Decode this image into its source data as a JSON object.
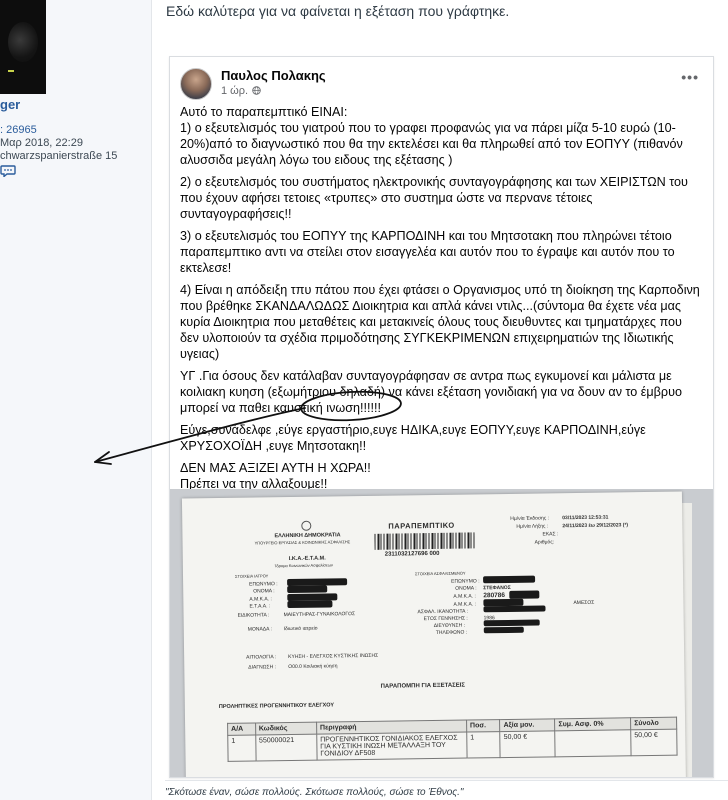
{
  "sidebar": {
    "username": "ger",
    "posts": ": 26965",
    "joined": "Μαρ 2018, 22:29",
    "location": "chwarzspanierstraße 15",
    "chat_icon": "speech-bubble-icon"
  },
  "post": {
    "intro": "Εδώ καλύτερα για να φαίνεται η εξέταση που γράφτηκε."
  },
  "fb": {
    "author": "Παυλος Πολακης",
    "time": "1 ώρ.",
    "audience_icon": "globe-icon",
    "more_icon": "more-horizontal-icon",
    "more": "•••",
    "p1": "Αυτό το παραπεμπτικό ΕΙΝΑΙ:",
    "p2": "1) ο εξευτελισμός του γιατρού που το γραφει προφανώς για να πάρει μίζα 5-10 ευρώ (10-20%)από το διαγνωστικό που θα την εκτελέσει και θα πληρωθεί από τον ΕΟΠΥΥ  (πιθανόν αλυσσιδα μεγάλη λόγω του ειδους της εξέτασης )",
    "p3": "2) ο εξευτελισμός του συστήματος ηλεκτρονικής συνταγογράφησης και των ΧΕΙΡΙΣΤΩΝ του που έχουν αφήσει τετοιες «τρυπες» στο συστημα ώστε να περνανε τέτοιες συνταγογραφήσεις!!",
    "p4": "3) ο εξευτελισμός του ΕΟΠΥΥ της ΚΑΡΠΟΔΙΝΗ και του Μητσοτακη που πληρώνει τέτοιο παραπεμπτικο αντι να στείλει στον εισαγγελέα και αυτόν που το έγραψε και αυτόν που το εκτελεσε!",
    "p5": "4) Είναι η απόδειξη τπυ πάτου που έχει φτάσει ο Οργανισμος υπό τη διοίκηση της Καρποδινη που βρέθηκε ΣΚΑΝΔΑΛΩΔΩΣ Διοικητρια και απλά κάνει ντιλς...(σύντομα θα έχετε νέα μας κυρία Διοικητρια που μεταθέτεις και μετακινείς όλους τους διευθυντες και τμηματάρχες που δεν υλοποιούν τα σχέδια πριμοδότησης ΣΥΓΚΕΚΡΙΜΕΝΩΝ επιχειρηματιών της Ιδιωτικής υγειας)",
    "p6": "ΥΓ .Για όσους δεν κατάλαβαν συνταγογράφησαν σε αντρα πως εγκυμονεί και μάλιστα με κοιλιακη κυηση (εξωμήτριου δηλαδή) να κάνει εξέταση γονιδιακή για να δουν αν το έμβρυο μπορεί να παθει καυστική ινωση!!!!!!",
    "p7": "Εύγε,συνάδελφε ,εύγε εργαστήριο,ευγε ΗΔΙΚΑ,ευγε ΕΟΠΥΥ,ευγε ΚΑΡΠΟΔΙΝΗ,εύγε ΧΡΥΣΟΧΟΪΔΗ ,ευγε Μητσοτακη!!",
    "p8a": "ΔΕΝ ΜΑΣ ΑΞΙΖΕΙ ΑΥΤΗ Η ΧΩΡΑ!!",
    "p8b": "Πρέπει να την αλλαξουμε!!"
  },
  "doc": {
    "ministry": "ΕΛΛΗΝΙΚΗ ΔΗΜΟΚΡΑΤΙΑ",
    "ministry_sub": "ΥΠΟΥΡΓΕΙΟ ΕΡΓΑΣΙΑΣ & ΚΟΙΝΩΝΙΚΗΣ ΑΣΦΑΛΙΣΗΣ",
    "org": "Ι.Κ.Α.-Ε.Τ.Α.Μ.",
    "org_sub": "Ίδρυμα Κοινωνικών Ασφαλίσεων",
    "title": "ΠΑΡΑΠΕΜΠΤΙΚΟ",
    "barcode_number": "2311032127696 000",
    "issue_label": "Ημ/νία Έκδοσης :",
    "issue_value": "03/11/2023 12:53:31",
    "expiry_label": "Ημ/νία Λήξης :",
    "expiry_value": "24/11/2023 έω 29/12/2023 (*)",
    "ekas": "ΕΚΑΣ :",
    "arithmos": "Αριθμός:",
    "doctor_section": "ΣΤΟΙΧΕΙΑ ΙΑΤΡΟΥ",
    "patient_section": "ΣΤΟΙΧΕΙΑ ΑΣΦΑΛΙΣΜΕΝΟΥ",
    "surname": "ΕΠΩΝΥΜΟ :",
    "name": "ΟΝΟΜΑ :",
    "amka": "Α.Μ.Κ.Α. :",
    "etaa": "Ε.Τ.Α.Α. :",
    "specialty_label": "ΕΙΔΙΚΟΤΗΤΑ :",
    "specialty_value": "ΜΑΙΕΥΤΗΡΑΣ-ΓΥΝΑΙΚΟΛΟΓΟΣ",
    "unit_label": "ΜΟΝΑΔΑ :",
    "unit_value": "Ιδιωτικό ιατρείο",
    "patient_name": "ΣΤΕΦΑΝΟΣ",
    "patient_amka": "280786",
    "direct": "ΑΜΕΣΟΣ",
    "insurer_label": "ΑΣΦΑΛ. ΙΚΑΝΟΤΗΤΑ :",
    "birth_label": "ΕΤΟΣ ΓΕΝΝΗΣΗΣ :",
    "birth_value": "1986",
    "address_label": "ΔΙΕΥΘΥΝΣΗ :",
    "phone_label": "ΤΗΛΕΦΩΝΟ :",
    "reason_label": "ΑΙΤΙΟΛΟΓΙΑ :",
    "reason_value": "ΚΥΗΣΗ - ΕΛΕΓΧΟΣ ΚΥΣΤΙΚΗΣ ΙΝΩΣΗΣ",
    "diagnosis_label": "ΔΙΑΓΝΩΣΗ :",
    "diagnosis_value": "O00.0 Κοιλιακή κύηση",
    "referral_title": "ΠΑΡΑΠΟΜΠΗ ΓΙΑ ΕΞΕΤΑΣΕΙΣ",
    "section": "ΠΡΟΛΗΠΤΙΚΕΣ ΠΡΟΓΕΝΝΗΤΙΚΟΥ ΕΛΕΓΧΟΥ",
    "table": {
      "headers": [
        "Α/Α",
        "Κωδικός",
        "Περιγραφή",
        "Ποσ.",
        "Αξία μον.",
        "Συμ. Ασφ. 0%",
        "Σύνολο"
      ],
      "rows": [
        [
          "1",
          "550000021",
          "ΠΡΟΓΕΝΝΗΤΙΚΟΣ ΓΟΝΙΔΙΑΚΟΣ ΕΛΕΓΧΟΣ ΓΙΑ ΚΥΣΤΙΚΗ ΙΝΩΣΗ ΜΕΤΑΛΛΑΞΗ ΤΟΥ ΓΟΝΙΔΙΟΥ ΔF508",
          "1",
          "50,00 €",
          "",
          "50,00 €"
        ]
      ]
    }
  },
  "signature": "\"Σκότωσε έναν, σώσε πολλούς. Σκότωσε πολλούς, σώσε το Έθνος.\""
}
